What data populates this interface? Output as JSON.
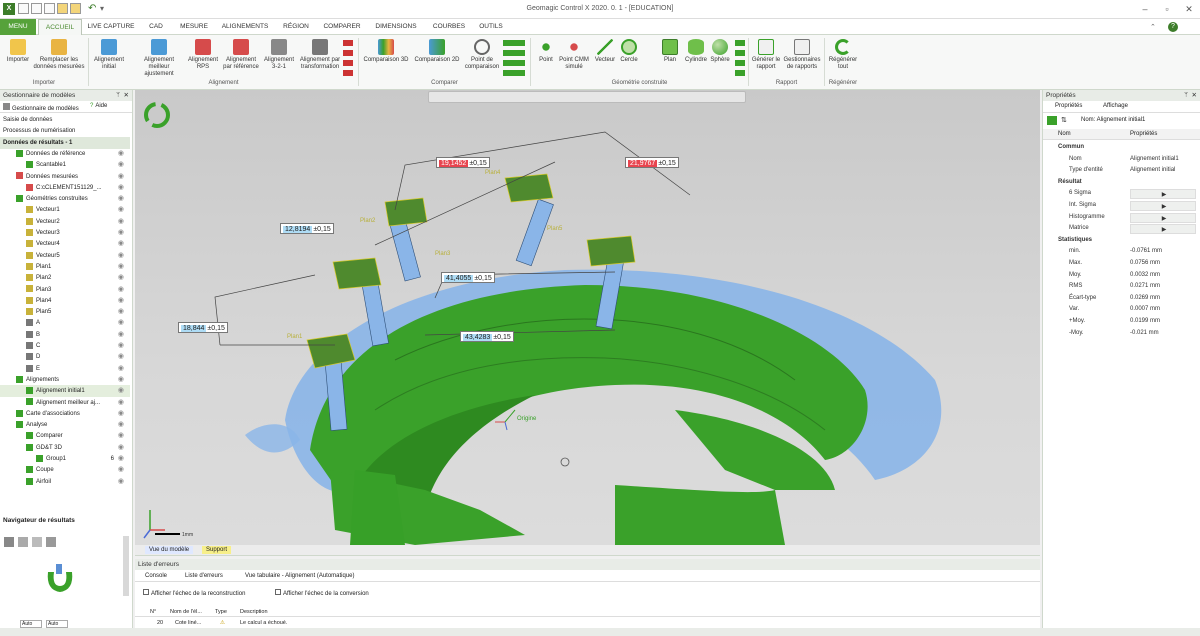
{
  "app": {
    "title": "Geomagic Control X 2020. 0. 1 - [EDUCATION]"
  },
  "colors": {
    "accent": "#56a23a",
    "red_label": "#e8454f",
    "blue_label": "#aedcf5",
    "model_green": "#3aa12a",
    "model_blue": "#8ab5e8"
  },
  "tabs": [
    "MENU",
    "ACCUEIL",
    "LIVE CAPTURE",
    "CAD",
    "MESURE",
    "ALIGNEMENTS",
    "RÉGION",
    "COMPARER",
    "DIMENSIONS",
    "COURBES",
    "OUTILS"
  ],
  "ribbon": {
    "buttons": [
      {
        "label": "Importer",
        "icon": "import-icon"
      },
      {
        "label": "Remplacer les données mesurées",
        "icon": "replace-data-icon"
      },
      {
        "label": "Alignement initial",
        "icon": "initial-align-icon"
      },
      {
        "label": "Alignement meilleur ajustement",
        "icon": "best-fit-icon"
      },
      {
        "label": "Alignement RPS",
        "icon": "rps-icon"
      },
      {
        "label": "Alignement par référence",
        "icon": "ref-align-icon"
      },
      {
        "label": "Alignement 3-2-1",
        "icon": "align-321-icon"
      },
      {
        "label": "Alignement par transformation",
        "icon": "transform-icon"
      },
      {
        "label": "Comparaison 3D",
        "icon": "compare3d-icon"
      },
      {
        "label": "Comparaison 2D",
        "icon": "compare2d-icon"
      },
      {
        "label": "Point de comparaison",
        "icon": "compare-point-icon"
      },
      {
        "label": "Point",
        "icon": "point-icon"
      },
      {
        "label": "Point CMM simulé",
        "icon": "cmm-point-icon"
      },
      {
        "label": "Vecteur",
        "icon": "vector-icon"
      },
      {
        "label": "Cercle",
        "icon": "circle-icon"
      },
      {
        "label": "Plan",
        "icon": "plane-icon"
      },
      {
        "label": "Cylindre",
        "icon": "cylinder-icon"
      },
      {
        "label": "Sphère",
        "icon": "sphere-icon"
      },
      {
        "label": "Générer le rapport",
        "icon": "report-icon"
      },
      {
        "label": "Gestionnaires de rapports",
        "icon": "report-manager-icon"
      },
      {
        "label": "Régénérer tout",
        "icon": "regenerate-icon"
      }
    ],
    "groups": [
      "Importer",
      "Alignement",
      "Comparer",
      "Géométrie construite",
      "Rapport",
      "Régénérer"
    ]
  },
  "left": {
    "panel_title": "Gestionnaire de modèles",
    "subtabs": [
      "Gestionnaire de modèles",
      "Aide"
    ],
    "items": [
      {
        "label": "Saisie de données",
        "level": 0,
        "type": "section"
      },
      {
        "label": "Processus de numérisation",
        "level": 0,
        "type": "section"
      },
      {
        "label": "Données de résultats - 1",
        "level": 0,
        "type": "header"
      },
      {
        "label": "Données de référence",
        "level": 1,
        "icon": "reference-icon"
      },
      {
        "label": "Scantable1",
        "level": 2,
        "icon": "scan-icon"
      },
      {
        "label": "Données mesurées",
        "level": 1,
        "icon": "measured-icon"
      },
      {
        "label": "C:cCLEMENT151129_...",
        "level": 2,
        "icon": "mesh-icon"
      },
      {
        "label": "Géométries construites",
        "level": 1,
        "icon": "geometry-icon"
      },
      {
        "label": "Vecteur1",
        "level": 2,
        "icon": "vector-icon"
      },
      {
        "label": "Vecteur2",
        "level": 2,
        "icon": "vector-icon"
      },
      {
        "label": "Vecteur3",
        "level": 2,
        "icon": "vector-icon"
      },
      {
        "label": "Vecteur4",
        "level": 2,
        "icon": "vector-icon"
      },
      {
        "label": "Vecteur5",
        "level": 2,
        "icon": "vector-icon"
      },
      {
        "label": "Plan1",
        "level": 2,
        "icon": "plane-icon"
      },
      {
        "label": "Plan2",
        "level": 2,
        "icon": "plane-icon"
      },
      {
        "label": "Plan3",
        "level": 2,
        "icon": "plane-icon"
      },
      {
        "label": "Plan4",
        "level": 2,
        "icon": "plane-icon"
      },
      {
        "label": "Plan5",
        "level": 2,
        "icon": "plane-icon"
      },
      {
        "label": "A",
        "level": 2,
        "icon": "point-icon"
      },
      {
        "label": "B",
        "level": 2,
        "icon": "point-icon"
      },
      {
        "label": "C",
        "level": 2,
        "icon": "point-icon"
      },
      {
        "label": "D",
        "level": 2,
        "icon": "point-icon"
      },
      {
        "label": "E",
        "level": 2,
        "icon": "point-icon"
      },
      {
        "label": "Alignements",
        "level": 1,
        "icon": "alignment-icon"
      },
      {
        "label": "Alignement initial1",
        "level": 2,
        "icon": "align-icon",
        "selected": true
      },
      {
        "label": "Alignement meilleur aj...",
        "level": 2,
        "icon": "align-icon"
      },
      {
        "label": "Carte d'associations",
        "level": 1,
        "icon": "map-icon"
      },
      {
        "label": "Analyse",
        "level": 1,
        "icon": "analysis-icon"
      },
      {
        "label": "Comparer",
        "level": 2,
        "icon": "compare-icon"
      },
      {
        "label": "GD&T 3D",
        "level": 2,
        "icon": "gdt-icon"
      },
      {
        "label": "Group1",
        "level": 3,
        "icon": "group-icon",
        "count": "6"
      },
      {
        "label": "Coupe",
        "level": 2,
        "icon": "section-icon"
      },
      {
        "label": "Airfoil",
        "level": 2,
        "icon": "airfoil-icon"
      }
    ],
    "navigator_title": "Navigateur de résultats",
    "bottom_dropdowns": [
      "Auto",
      "Auto"
    ]
  },
  "viewport": {
    "dims": [
      {
        "value": "19,1452",
        "tol": "±0,15",
        "style": "red"
      },
      {
        "value": "21,9767",
        "tol": "±0,15",
        "style": "red"
      },
      {
        "value": "12,8194",
        "tol": "±0,15",
        "style": "blue"
      },
      {
        "value": "41,4055",
        "tol": "±0,15",
        "style": "blue"
      },
      {
        "value": "18,844",
        "tol": "±0,15",
        "style": "blue"
      },
      {
        "value": "43,4283",
        "tol": "±0,15",
        "style": "blue"
      }
    ],
    "plane_labels": [
      "Plan1",
      "Plan2",
      "Plan3",
      "Plan4",
      "Plan5"
    ],
    "origin_label": "Origine",
    "scale_label": "1mm",
    "tabs": [
      "Vue du modèle",
      "Support"
    ]
  },
  "right": {
    "title": "Propriétés",
    "tabs": [
      "Propriétés",
      "Affichage"
    ],
    "name_field": "Nom: Alignement initial1",
    "col_headers": [
      "Nom",
      "Propriétés"
    ],
    "rows": [
      {
        "k": "Commun",
        "type": "section"
      },
      {
        "k": "Nom",
        "v": "Alignement initial1"
      },
      {
        "k": "Type d'entité",
        "v": "Alignement initial"
      },
      {
        "k": "Résultat",
        "type": "section"
      },
      {
        "k": "6 Sigma",
        "v": "▶",
        "type": "btn"
      },
      {
        "k": "Int. Sigma",
        "v": "▶",
        "type": "btn"
      },
      {
        "k": "Histogramme",
        "v": "▶",
        "type": "btn"
      },
      {
        "k": "Matrice",
        "v": "▶",
        "type": "btn"
      },
      {
        "k": "Statistiques",
        "type": "section"
      },
      {
        "k": "min.",
        "v": "-0.0761 mm"
      },
      {
        "k": "Max.",
        "v": "0.0756 mm"
      },
      {
        "k": "Moy.",
        "v": "0.0032 mm"
      },
      {
        "k": "RMS",
        "v": "0.0271 mm"
      },
      {
        "k": "Écart-type",
        "v": "0.0269 mm"
      },
      {
        "k": "Var.",
        "v": "0.0007 mm"
      },
      {
        "k": "+Moy.",
        "v": "0.0199 mm"
      },
      {
        "k": "-Moy.",
        "v": "-0.021 mm"
      }
    ]
  },
  "bottom": {
    "title": "Liste d'erreurs",
    "tabs": [
      "Console",
      "Liste d'erreurs",
      "Vue tabulaire - Alignement (Automatique)"
    ],
    "checkboxes": [
      "Afficher l'échec de la reconstruction",
      "Afficher l'échec de la conversion"
    ],
    "columns": [
      "N°",
      "Nom de l'él...",
      "Type",
      "Description"
    ],
    "row": {
      "n": "20",
      "name": "Cote liné...",
      "type": "⚠",
      "desc": "Le calcul a échoué."
    }
  }
}
